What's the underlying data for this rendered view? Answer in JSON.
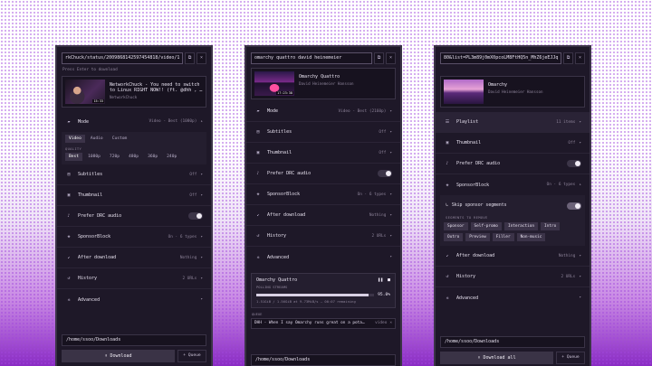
{
  "panel1": {
    "url": "rkChuck/status/2009868142597454818/video/1",
    "copy_icon": "copy-icon",
    "clear_icon": "×",
    "hint": "Press Enter to download",
    "media": {
      "title": "NetworkChuck - You need to switch to Linux RIGHT NOW!! (ft. @dhh , …",
      "channel": "NetworkChuck",
      "duration": "15:33"
    },
    "mode": {
      "label": "Mode",
      "value": "Video - Best (1080p)"
    },
    "mode_tabs": [
      "Video",
      "Audio",
      "Custom"
    ],
    "quality_label": "QUALITY",
    "qualities": [
      "Best",
      "1080p",
      "720p",
      "480p",
      "360p",
      "240p"
    ],
    "rows": [
      {
        "label": "Subtitles",
        "value": "Off",
        "chev": "▾"
      },
      {
        "label": "Thumbnail",
        "value": "Off",
        "chev": "▾"
      },
      {
        "label": "Prefer DRC audio"
      },
      {
        "label": "SponsorBlock",
        "value": "On · 6 types",
        "chev": "▾"
      },
      {
        "label": "After download",
        "value": "Nothing",
        "chev": "▾"
      },
      {
        "label": "History",
        "value": "2 URLs",
        "chev": "▾"
      },
      {
        "label": "Advanced",
        "chev": "▾"
      }
    ],
    "path": "/home/ssoo/Downloads",
    "download": "Download",
    "queue": "Queue"
  },
  "panel2": {
    "url": "omarchy quattro david heinemeier",
    "copy_icon": "copy-icon",
    "clear_icon": "×",
    "media": {
      "title": "Omarchy Quattro",
      "channel": "David Heinemeier Hansson",
      "duration": "17:23:38"
    },
    "rows": [
      {
        "label": "Mode",
        "value": "Video - Best (2160p)",
        "chev": "▾"
      },
      {
        "label": "Subtitles",
        "value": "Off",
        "chev": "▾"
      },
      {
        "label": "Thumbnail",
        "value": "Off",
        "chev": "▾"
      },
      {
        "label": "Prefer DRC audio"
      },
      {
        "label": "SponsorBlock",
        "value": "On · 6 types",
        "chev": "▾"
      },
      {
        "label": "After download",
        "value": "Nothing",
        "chev": "▾"
      },
      {
        "label": "History",
        "value": "2 URLs",
        "chev": "▾"
      },
      {
        "label": "Advanced",
        "chev": "▾"
      }
    ],
    "progress": {
      "title": "Omarchy Quattro",
      "status": "POLLING STREAMS",
      "percent": 95.0,
      "percent_label": "95.0%",
      "stats": "1.51GiB / 1.56GiB at 9.73MiB/s — 00:07 remaining"
    },
    "queue_label": "QUEUE",
    "queue_item": {
      "title": "DHH - When I say Omarchy runs great on a pota…",
      "kind": "video",
      "close": "×"
    },
    "path": "/home/ssoo/Downloads"
  },
  "panel3": {
    "url": "80&list=PL3m89j0mX0pcoLM8FtHQ5n_MhZ6jeEJJq",
    "copy_icon": "copy-icon",
    "clear_icon": "×",
    "media": {
      "title": "Omarchy",
      "channel": "David Heinemeier Hansson"
    },
    "rows_top": [
      {
        "label": "Playlist",
        "value": "11 items",
        "chev": "▾"
      },
      {
        "label": "Thumbnail",
        "value": "Off",
        "chev": "▾"
      },
      {
        "label": "Prefer DRC audio"
      },
      {
        "label": "SponsorBlock",
        "value": "On · 6 types",
        "chev": "▾"
      }
    ],
    "sb": {
      "skip_label": "Skip sponsor segments",
      "segments_label": "SEGMENTS TO REMOVE",
      "segments": [
        "Sponsor",
        "Self-promo",
        "Interaction",
        "Intro",
        "Outro",
        "Preview",
        "Filler",
        "Non-music"
      ]
    },
    "rows_bottom": [
      {
        "label": "After download",
        "value": "Nothing",
        "chev": "▾"
      },
      {
        "label": "History",
        "value": "2 URLs",
        "chev": "▾"
      },
      {
        "label": "Advanced",
        "chev": "▾"
      }
    ],
    "path": "/home/ssoo/Downloads",
    "download": "Download all",
    "queue": "Queue"
  }
}
